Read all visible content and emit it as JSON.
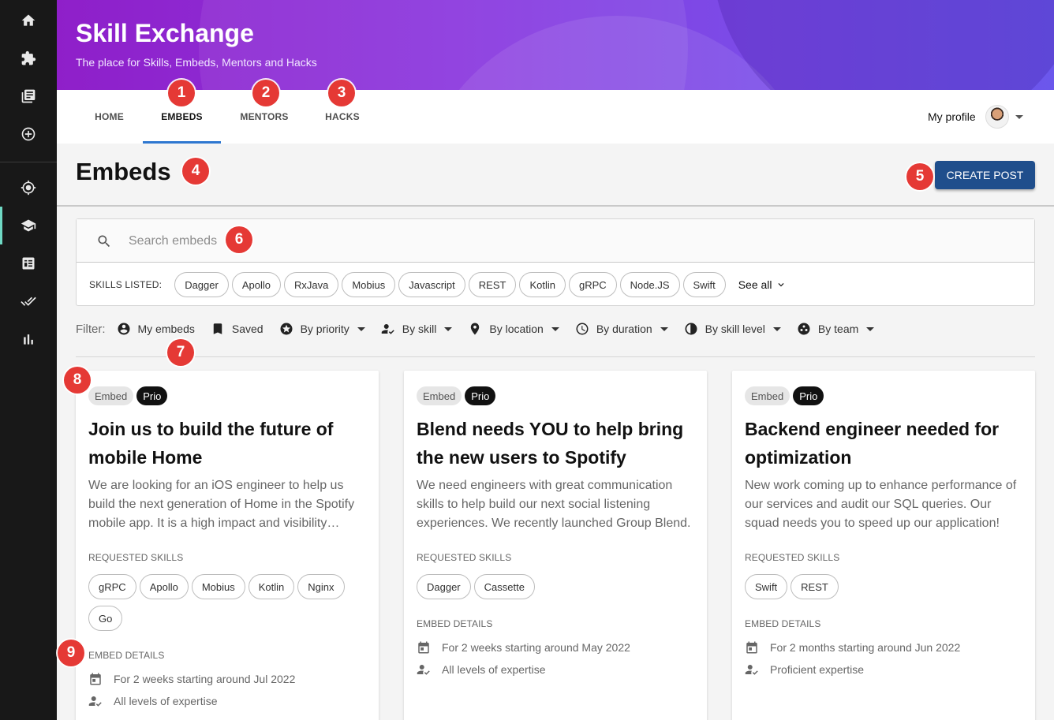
{
  "sidebar": {
    "items": [
      {
        "icon": "home-icon"
      },
      {
        "icon": "puzzle-icon"
      },
      {
        "icon": "library-icon"
      },
      {
        "icon": "plus-circle-icon"
      },
      {
        "icon": "target-icon"
      },
      {
        "icon": "graduation-cap-icon"
      },
      {
        "icon": "dashboard-icon"
      },
      {
        "icon": "double-check-icon"
      },
      {
        "icon": "bar-chart-icon"
      }
    ],
    "active_index": 5,
    "accent_color": "#6fd9c4"
  },
  "header": {
    "title": "Skill Exchange",
    "subtitle": "The place for Skills, Embeds, Mentors and Hacks"
  },
  "tabs": [
    {
      "label": "HOME",
      "active": false
    },
    {
      "label": "EMBEDS",
      "active": true
    },
    {
      "label": "MENTORS",
      "active": false
    },
    {
      "label": "HACKS",
      "active": false
    }
  ],
  "profile": {
    "label": "My profile"
  },
  "page": {
    "title": "Embeds",
    "create_button": "CREATE POST"
  },
  "search": {
    "placeholder": "Search embeds",
    "skills_label": "SKILLS LISTED:",
    "skills": [
      "Dagger",
      "Apollo",
      "RxJava",
      "Mobius",
      "Javascript",
      "REST",
      "Kotlin",
      "gRPC",
      "Node.JS",
      "Swift"
    ],
    "see_all": "See all"
  },
  "filters": {
    "label": "Filter:",
    "items": [
      {
        "label": "My embeds",
        "icon": "account-circle-icon",
        "dropdown": false
      },
      {
        "label": "Saved",
        "icon": "bookmark-icon",
        "dropdown": false
      },
      {
        "label": "By priority",
        "icon": "star-circle-icon",
        "dropdown": true
      },
      {
        "label": "By skill",
        "icon": "person-check-icon",
        "dropdown": true
      },
      {
        "label": "By location",
        "icon": "location-pin-icon",
        "dropdown": true
      },
      {
        "label": "By duration",
        "icon": "clock-icon",
        "dropdown": true
      },
      {
        "label": "By skill level",
        "icon": "contrast-icon",
        "dropdown": true
      },
      {
        "label": "By team",
        "icon": "team-icon",
        "dropdown": true
      }
    ]
  },
  "cards": [
    {
      "tag": "Embed",
      "badge": "Prio",
      "title": "Join us to build the future of mobile Home",
      "description": "We are looking for an iOS engineer to help us build the next generation of Home in the Spotify mobile app. It is a high impact and visibility project.",
      "requested_label": "REQUESTED SKILLS",
      "skills": [
        "gRPC",
        "Apollo",
        "Mobius",
        "Kotlin",
        "Nginx",
        "Go"
      ],
      "details_label": "EMBED DETAILS",
      "duration": "For 2 weeks starting around Jul 2022",
      "expertise": "All levels of expertise"
    },
    {
      "tag": "Embed",
      "badge": "Prio",
      "title": "Blend needs YOU to help bring the new users to Spotify",
      "description": "We need engineers with great communication skills to help build our next social listening experiences. We recently launched Group Blend.",
      "requested_label": "REQUESTED SKILLS",
      "skills": [
        "Dagger",
        "Cassette"
      ],
      "details_label": "EMBED DETAILS",
      "duration": "For 2 weeks starting around May 2022",
      "expertise": "All levels of expertise"
    },
    {
      "tag": "Embed",
      "badge": "Prio",
      "title": "Backend engineer needed for optimization",
      "description": "New work coming up to enhance performance of our services and audit our SQL queries. Our squad needs you to speed up our application!",
      "requested_label": "REQUESTED SKILLS",
      "skills": [
        "Swift",
        "REST"
      ],
      "details_label": "EMBED DETAILS",
      "duration": "For 2 months starting around Jun 2022",
      "expertise": "Proficient expertise"
    }
  ],
  "annotations": [
    "1",
    "2",
    "3",
    "4",
    "5",
    "6",
    "7",
    "8",
    "9"
  ],
  "colors": {
    "primary_button": "#1f4e8c",
    "tab_underline": "#2e77d0",
    "annotation": "#e53935"
  }
}
